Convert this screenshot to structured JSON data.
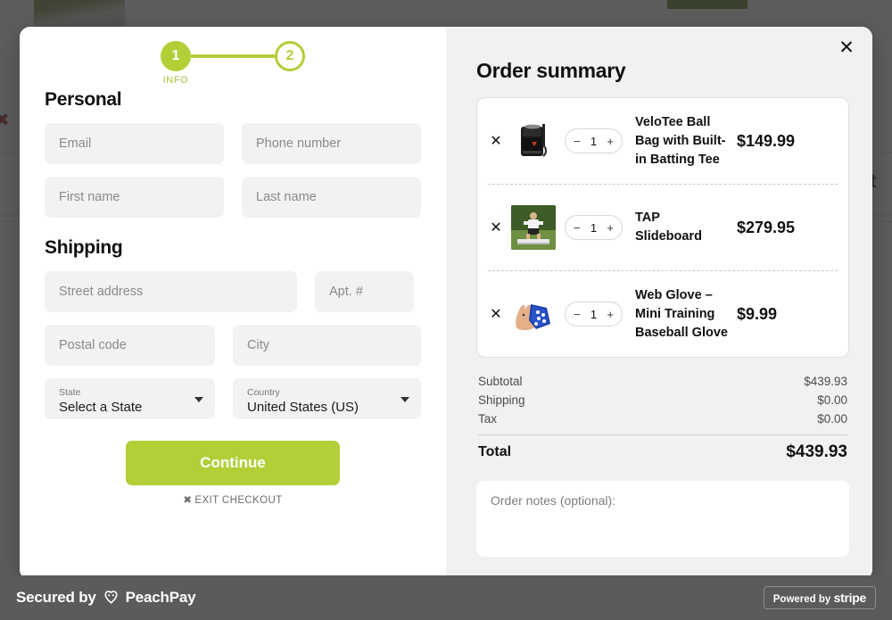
{
  "background": {
    "cart_text": "art",
    "red_glyph": "✖"
  },
  "modal": {
    "close_icon": "✕",
    "stepper": {
      "steps": [
        {
          "number": "1",
          "label": "INFO",
          "state": "active"
        },
        {
          "number": "2",
          "label": "",
          "state": "inactive"
        }
      ]
    },
    "form": {
      "personal_heading": "Personal",
      "shipping_heading": "Shipping",
      "fields": {
        "email_placeholder": "Email",
        "phone_placeholder": "Phone number",
        "first_name_placeholder": "First name",
        "last_name_placeholder": "Last name",
        "street_placeholder": "Street address",
        "apt_placeholder": "Apt. #",
        "postal_placeholder": "Postal code",
        "city_placeholder": "City"
      },
      "state_select": {
        "label": "State",
        "value": "Select a State"
      },
      "country_select": {
        "label": "Country",
        "value": "United States (US)"
      },
      "continue_label": "Continue",
      "exit_label": "EXIT CHECKOUT",
      "exit_icon": "✖"
    },
    "summary": {
      "title": "Order summary",
      "remove_icon": "✕",
      "minus_icon": "−",
      "plus_icon": "+",
      "items": [
        {
          "name": "VeloTee Ball Bag with Built-in Batting Tee",
          "quantity": "1",
          "price": "$149.99",
          "thumb": "ball-bag-photo"
        },
        {
          "name": "TAP Slideboard",
          "quantity": "1",
          "price": "$279.95",
          "thumb": "slideboard-photo"
        },
        {
          "name": "Web Glove – Mini Training Baseball Glove",
          "quantity": "1",
          "price": "$9.99",
          "thumb": "web-glove-photo"
        }
      ],
      "totals": [
        {
          "label": "Subtotal",
          "value": "$439.93"
        },
        {
          "label": "Shipping",
          "value": "$0.00"
        },
        {
          "label": "Tax",
          "value": "$0.00"
        }
      ],
      "total": {
        "label": "Total",
        "value": "$439.93"
      },
      "notes_placeholder": "Order notes (optional):"
    }
  },
  "footer": {
    "secured_prefix": "Secured by",
    "brand": "PeachPay",
    "stripe_prefix": "Powered by",
    "stripe_name": "stripe"
  },
  "colors": {
    "accent_green": "#b2cf38",
    "overlay": "#2a2a2a",
    "footer_bg": "#5b5b5b",
    "field_bg": "#f2f2f2",
    "summary_bg": "#f1f1f1"
  }
}
